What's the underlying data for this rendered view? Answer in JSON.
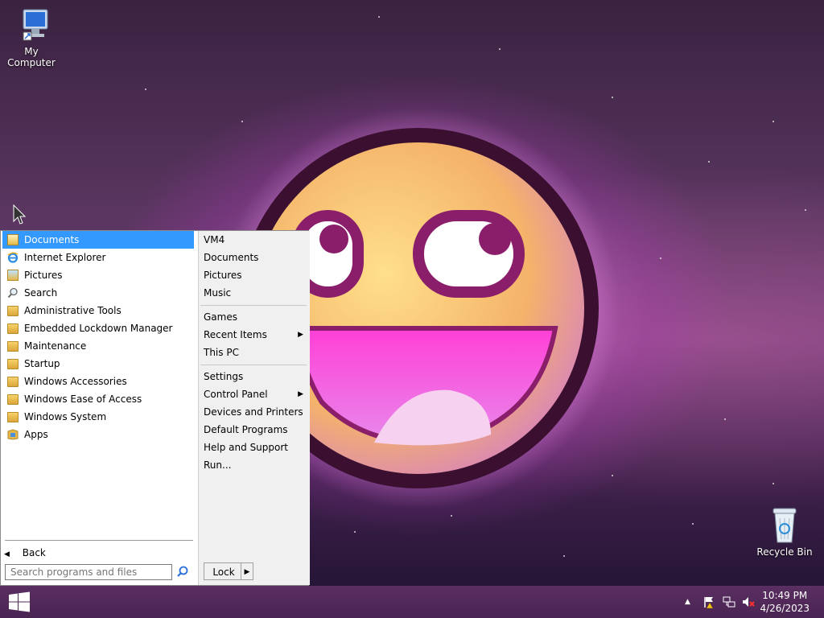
{
  "desktop": {
    "icons": [
      {
        "label": "My Computer",
        "icon": "computer-icon"
      },
      {
        "label": "Recycle Bin",
        "icon": "recycle-bin-icon"
      }
    ]
  },
  "start_menu": {
    "left_items": [
      {
        "label": "Documents",
        "icon": "documents-icon",
        "selected": true
      },
      {
        "label": "Internet Explorer",
        "icon": "internet-explorer-icon"
      },
      {
        "label": "Pictures",
        "icon": "pictures-icon"
      },
      {
        "label": "Search",
        "icon": "search-icon"
      },
      {
        "label": "Administrative Tools",
        "icon": "folder-icon"
      },
      {
        "label": "Embedded Lockdown Manager",
        "icon": "folder-icon"
      },
      {
        "label": "Maintenance",
        "icon": "folder-icon"
      },
      {
        "label": "Startup",
        "icon": "folder-icon"
      },
      {
        "label": "Windows Accessories",
        "icon": "folder-icon"
      },
      {
        "label": "Windows Ease of Access",
        "icon": "folder-icon"
      },
      {
        "label": "Windows System",
        "icon": "folder-icon"
      },
      {
        "label": "Apps",
        "icon": "apps-icon"
      }
    ],
    "back_label": "Back",
    "search_placeholder": "Search programs and files",
    "right_items": [
      {
        "label": "VM4"
      },
      {
        "label": "Documents"
      },
      {
        "label": "Pictures"
      },
      {
        "label": "Music"
      },
      {
        "label": "Games"
      },
      {
        "label": "Recent Items",
        "submenu": true
      },
      {
        "label": "This PC"
      },
      {
        "label": "Settings"
      },
      {
        "label": "Control Panel",
        "submenu": true
      },
      {
        "label": "Devices and Printers"
      },
      {
        "label": "Default Programs"
      },
      {
        "label": "Help and Support"
      },
      {
        "label": "Run..."
      }
    ],
    "lock_label": "Lock"
  },
  "taskbar": {
    "time": "10:49 PM",
    "date": "4/26/2023",
    "tray_icons": [
      "chevron-up-icon",
      "action-center-flag-icon",
      "network-icon",
      "volume-muted-icon"
    ]
  },
  "colors": {
    "selection": "#3399ff",
    "taskbar": "#4a2452"
  }
}
